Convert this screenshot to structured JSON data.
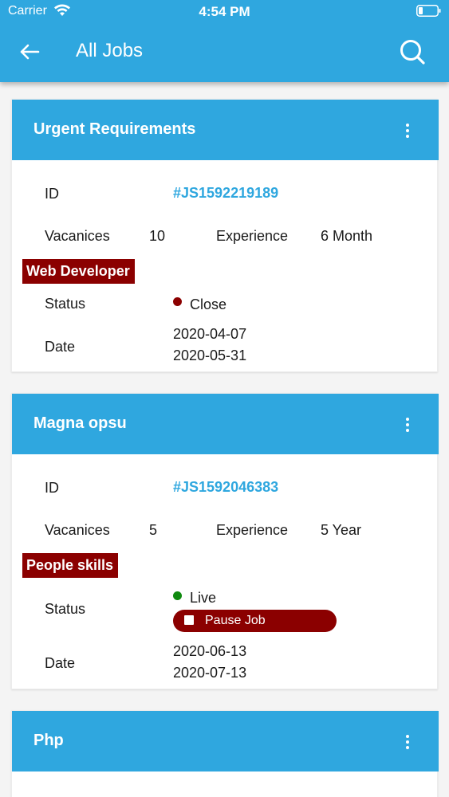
{
  "status_bar": {
    "carrier": "Carrier",
    "time": "4:54 PM",
    "wifi_icon": "wifi-icon",
    "battery_icon": "battery-icon"
  },
  "app_bar": {
    "title": "All Jobs",
    "back_icon": "back-arrow-icon",
    "search_icon": "search-icon"
  },
  "colors": {
    "primary": "#2fa7df",
    "tag_bg": "#8b0000",
    "status_close": "#8b0000",
    "status_live": "#0f8a0f"
  },
  "jobs": [
    {
      "title": "Urgent Requirements",
      "id_label": "ID",
      "id": "#JS1592219189",
      "vacancies_label": "Vacanices",
      "vacancies": "10",
      "experience_label": "Experience",
      "experience": "6 Month",
      "skill": "Web Developer",
      "status_label": "Status",
      "status": "Close",
      "date_label": "Date",
      "date_start": "2020-04-07",
      "date_end": "2020-05-31"
    },
    {
      "title": "Magna opsu",
      "id_label": "ID",
      "id": "#JS1592046383",
      "vacancies_label": "Vacanices",
      "vacancies": "5",
      "experience_label": "Experience",
      "experience": "5 Year",
      "skill": "People skills",
      "status_label": "Status",
      "status": "Live",
      "pause_label": "Pause Job",
      "date_label": "Date",
      "date_start": "2020-06-13",
      "date_end": "2020-07-13"
    },
    {
      "title": "Php"
    }
  ]
}
